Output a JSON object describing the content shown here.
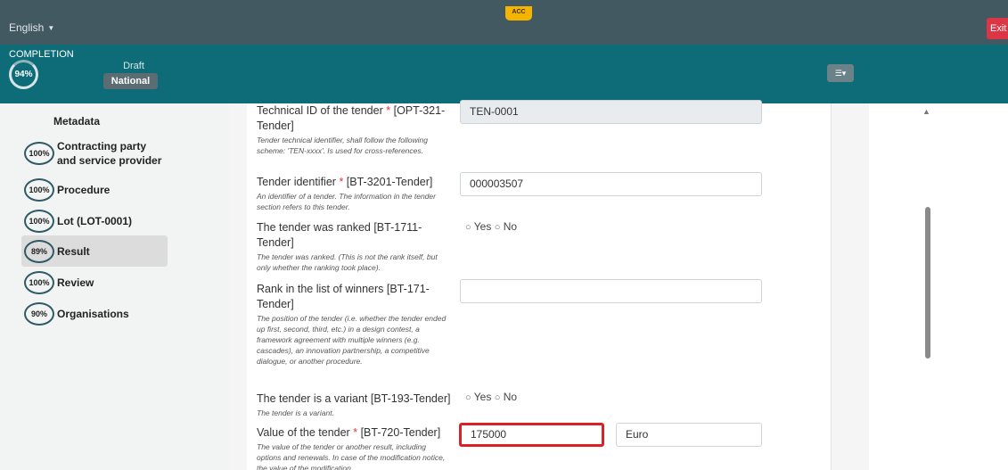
{
  "topbar": {
    "language": "English",
    "env_badge": "ACC",
    "exit_label": "Exit"
  },
  "completion": {
    "label": "COMPLETION",
    "percent": "94%",
    "status": "Draft",
    "scope": "National"
  },
  "sidebar": {
    "title": "Metadata",
    "items": [
      {
        "pct": "100%",
        "label": "Contracting party and service provider"
      },
      {
        "pct": "100%",
        "label": "Procedure"
      },
      {
        "pct": "100%",
        "label": "Lot (LOT-0001)"
      },
      {
        "pct": "89%",
        "label": "Result"
      },
      {
        "pct": "100%",
        "label": "Review"
      },
      {
        "pct": "90%",
        "label": "Organisations"
      }
    ]
  },
  "form": {
    "technical_id": {
      "label": "Technical ID of the tender",
      "code": "[OPT-321-Tender]",
      "desc": "Tender technical identifier, shall follow the following scheme: 'TEN-xxxx'. Is used for cross-references.",
      "value": "TEN-0001"
    },
    "tender_identifier": {
      "label": "Tender identifier",
      "code": "[BT-3201-Tender]",
      "desc": "An identifier of a tender. The information in the tender section refers to this tender.",
      "value": "000003507"
    },
    "ranked": {
      "label": "The tender was ranked [BT-1711-Tender]",
      "desc": "The tender was ranked. (This is not the rank itself, but only whether the ranking took place).",
      "yes": "Yes",
      "no": "No"
    },
    "rank": {
      "label": "Rank in the list of winners [BT-171-Tender]",
      "desc": "The position of the tender (i.e. whether the tender ended up first, second, third, etc.) in a design contest, a framework agreement with multiple winners (e.g. cascades), an innovation partnership, a competitive dialogue, or another procedure.",
      "value": ""
    },
    "variant": {
      "label": "The tender is a variant [BT-193-Tender]",
      "desc": "The tender is a variant.",
      "yes": "Yes",
      "no": "No"
    },
    "value": {
      "label": "Value of the tender",
      "code": "[BT-720-Tender]",
      "desc": "The value of the tender or another result, including options and renewals. In case of the modification notice, the value of the modification",
      "amount": "175000",
      "currency": "Euro"
    },
    "required_mark": "*"
  },
  "icons": {
    "radio": "radio-empty-icon",
    "settings": "sliders-icon",
    "caret": "caret-down-icon",
    "scroll_up": "arrow-up-icon"
  },
  "colors": {
    "topbar": "#435962",
    "completion_bar": "#0d6c77",
    "exit": "#dc3545",
    "badge": "#f5b400",
    "highlight": "#dd1f26"
  }
}
